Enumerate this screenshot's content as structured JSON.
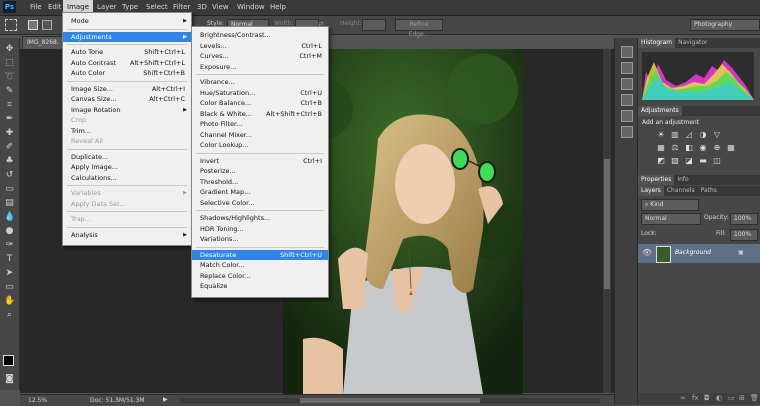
{
  "app": {
    "logo": "Ps"
  },
  "menubar": [
    "File",
    "Edit",
    "Image",
    "Layer",
    "Type",
    "Select",
    "Filter",
    "3D",
    "View",
    "Window",
    "Help"
  ],
  "options": {
    "style_label": "Style:",
    "style_value": "Normal",
    "width_label": "Width:",
    "height_label": "Height:",
    "refine_edge": "Refine Edge...",
    "workspace": "Photography"
  },
  "document": {
    "tab_title": "IMG_8268.",
    "zoom": "12.5%",
    "doc_size": "Doc: 51.3M/51.3M"
  },
  "image_menu": [
    {
      "label": "Mode",
      "shortcut": "",
      "submenu": true
    },
    {
      "sep": true
    },
    {
      "label": "Adjustments",
      "shortcut": "",
      "submenu": true,
      "active": true
    },
    {
      "sep": true
    },
    {
      "label": "Auto Tone",
      "shortcut": "Shift+Ctrl+L"
    },
    {
      "label": "Auto Contrast",
      "shortcut": "Alt+Shift+Ctrl+L"
    },
    {
      "label": "Auto Color",
      "shortcut": "Shift+Ctrl+B"
    },
    {
      "sep": true
    },
    {
      "label": "Image Size...",
      "shortcut": "Alt+Ctrl+I"
    },
    {
      "label": "Canvas Size...",
      "shortcut": "Alt+Ctrl+C"
    },
    {
      "label": "Image Rotation",
      "shortcut": "",
      "submenu": true
    },
    {
      "label": "Crop",
      "shortcut": "",
      "disabled": true
    },
    {
      "label": "Trim...",
      "shortcut": ""
    },
    {
      "label": "Reveal All",
      "shortcut": "",
      "disabled": true
    },
    {
      "sep": true
    },
    {
      "label": "Duplicate...",
      "shortcut": ""
    },
    {
      "label": "Apply Image...",
      "shortcut": ""
    },
    {
      "label": "Calculations...",
      "shortcut": ""
    },
    {
      "sep": true
    },
    {
      "label": "Variables",
      "shortcut": "",
      "submenu": true,
      "disabled": true
    },
    {
      "label": "Apply Data Set...",
      "shortcut": "",
      "disabled": true
    },
    {
      "sep": true
    },
    {
      "label": "Trap...",
      "shortcut": "",
      "disabled": true
    },
    {
      "sep": true
    },
    {
      "label": "Analysis",
      "shortcut": "",
      "submenu": true
    }
  ],
  "adjust_menu": [
    {
      "label": "Brightness/Contrast...",
      "shortcut": ""
    },
    {
      "label": "Levels...",
      "shortcut": "Ctrl+L"
    },
    {
      "label": "Curves...",
      "shortcut": "Ctrl+M"
    },
    {
      "label": "Exposure...",
      "shortcut": ""
    },
    {
      "sep": true
    },
    {
      "label": "Vibrance...",
      "shortcut": ""
    },
    {
      "label": "Hue/Saturation...",
      "shortcut": "Ctrl+U"
    },
    {
      "label": "Color Balance...",
      "shortcut": "Ctrl+B"
    },
    {
      "label": "Black & White...",
      "shortcut": "Alt+Shift+Ctrl+B"
    },
    {
      "label": "Photo Filter...",
      "shortcut": ""
    },
    {
      "label": "Channel Mixer...",
      "shortcut": ""
    },
    {
      "label": "Color Lookup...",
      "shortcut": ""
    },
    {
      "sep": true
    },
    {
      "label": "Invert",
      "shortcut": "Ctrl+I"
    },
    {
      "label": "Posterize...",
      "shortcut": ""
    },
    {
      "label": "Threshold...",
      "shortcut": ""
    },
    {
      "label": "Gradient Map...",
      "shortcut": ""
    },
    {
      "label": "Selective Color...",
      "shortcut": ""
    },
    {
      "sep": true
    },
    {
      "label": "Shadows/Highlights...",
      "shortcut": ""
    },
    {
      "label": "HDR Toning...",
      "shortcut": ""
    },
    {
      "label": "Variations...",
      "shortcut": ""
    },
    {
      "sep": true
    },
    {
      "label": "Desaturate",
      "shortcut": "Shift+Ctrl+U",
      "highlight": true
    },
    {
      "label": "Match Color...",
      "shortcut": ""
    },
    {
      "label": "Replace Color...",
      "shortcut": ""
    },
    {
      "label": "Equalize",
      "shortcut": ""
    }
  ],
  "panels": {
    "top_tabs": [
      "Histogram",
      "Navigator"
    ],
    "adj_tab": "Adjustments",
    "adj_hint": "Add an adjustment",
    "mid_tabs": [
      "Properties",
      "Info"
    ],
    "layer_tabs": [
      "Layers",
      "Channels",
      "Paths"
    ],
    "kind": "Kind",
    "blend": "Normal",
    "opacity_label": "Opacity:",
    "opacity_value": "100%",
    "lock_label": "Lock:",
    "fill_label": "Fill:",
    "fill_value": "100%",
    "layer_name": "Background"
  },
  "colors": {
    "menu_highlight": "#2f86e8",
    "accent": "#4fb3ff"
  }
}
